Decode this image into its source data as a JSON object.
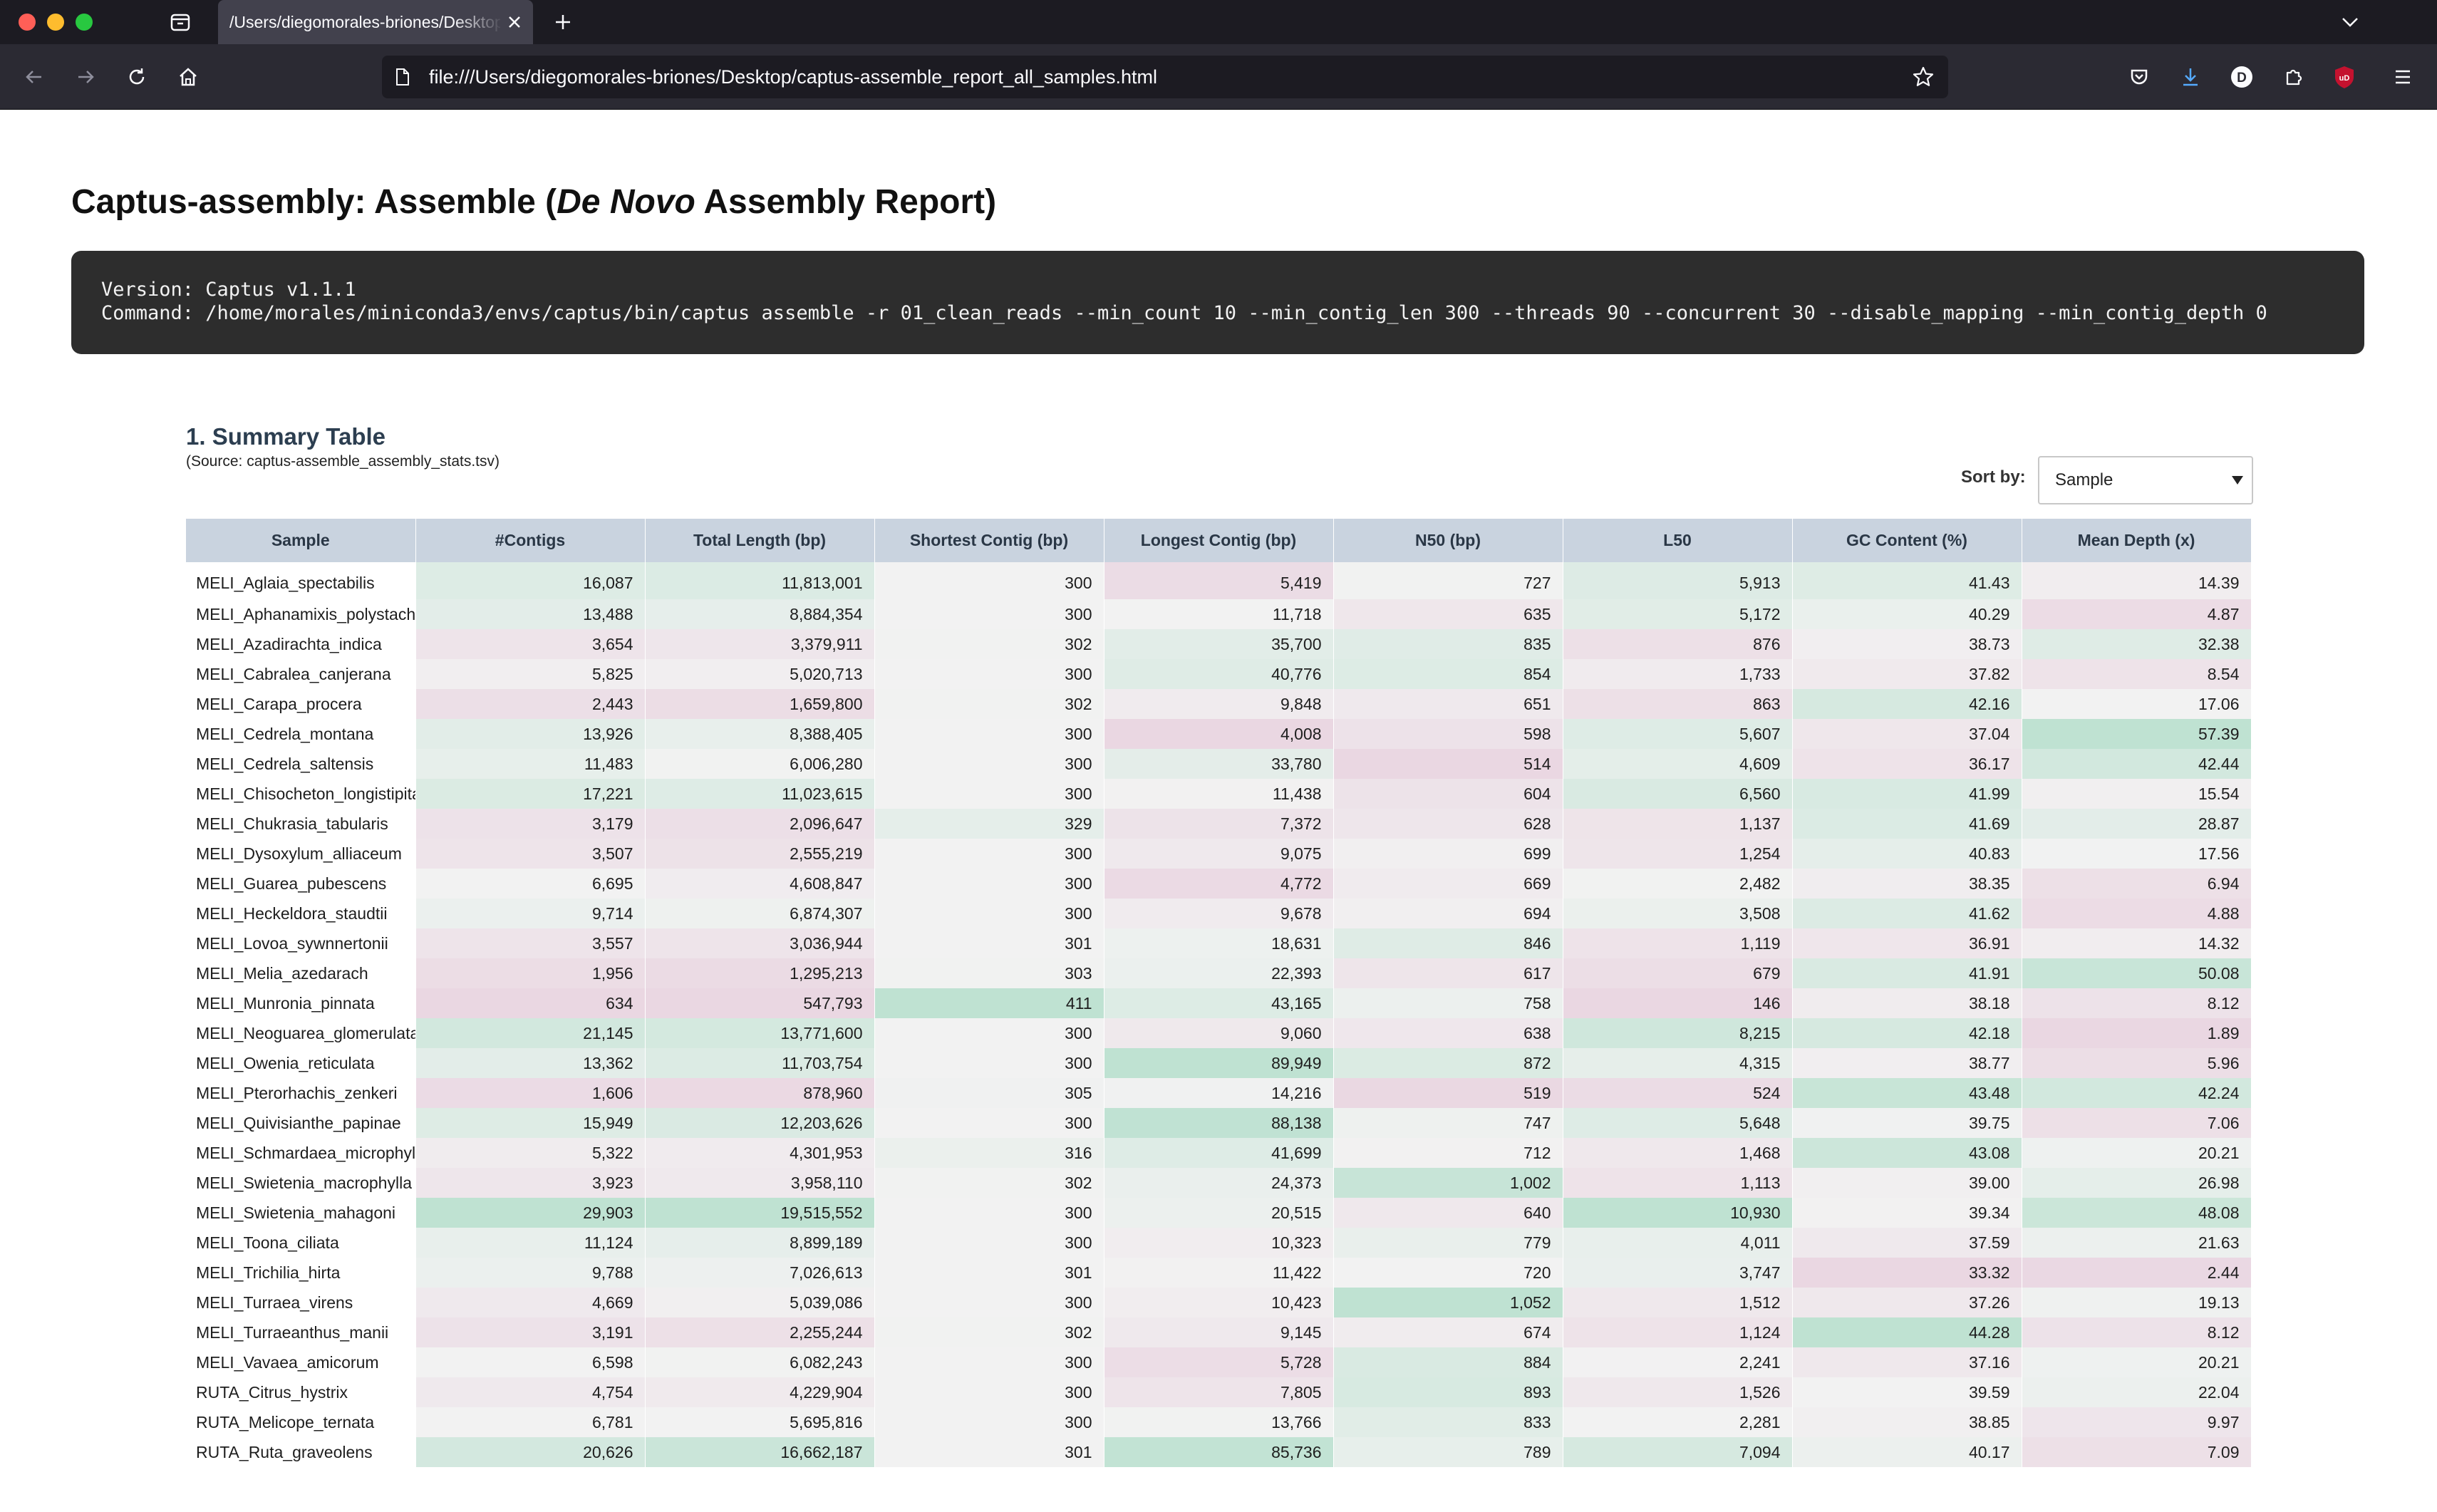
{
  "browser": {
    "tab_title": "/Users/diegomorales-briones/Desktop/captus-assemble_report_all_samples.html",
    "url": "file:///Users/diegomorales-briones/Desktop/captus-assemble_report_all_samples.html",
    "profile_initial": "D",
    "extension_badge": "uD"
  },
  "report": {
    "title_prefix": "Captus-assembly: Assemble (",
    "title_italic": "De Novo",
    "title_suffix": " Assembly Report)",
    "version_line": "Version: Captus v1.1.1",
    "command_line": "Command: /home/morales/miniconda3/envs/captus/bin/captus assemble -r 01_clean_reads --min_count 10 --min_contig_len 300 --threads 90 --concurrent 30 --disable_mapping --min_contig_depth 0"
  },
  "summary": {
    "section_title": "1. Summary Table",
    "source_note": "(Source: captus-assemble_assembly_stats.tsv)",
    "sort_label": "Sort by:",
    "sort_value": "Sample",
    "columns": [
      "Sample",
      "#Contigs",
      "Total Length (bp)",
      "Shortest Contig (bp)",
      "Longest Contig (bp)",
      "N50 (bp)",
      "L50",
      "GC Content (%)",
      "Mean Depth (x)"
    ],
    "rows": [
      [
        "MELI_Aglaia_spectabilis",
        "16,087",
        "11,813,001",
        "300",
        "5,419",
        "727",
        "5,913",
        "41.43",
        "14.39"
      ],
      [
        "MELI_Aphanamixis_polystachya",
        "13,488",
        "8,884,354",
        "300",
        "11,718",
        "635",
        "5,172",
        "40.29",
        "4.87"
      ],
      [
        "MELI_Azadirachta_indica",
        "3,654",
        "3,379,911",
        "302",
        "35,700",
        "835",
        "876",
        "38.73",
        "32.38"
      ],
      [
        "MELI_Cabralea_canjerana",
        "5,825",
        "5,020,713",
        "300",
        "40,776",
        "854",
        "1,733",
        "37.82",
        "8.54"
      ],
      [
        "MELI_Carapa_procera",
        "2,443",
        "1,659,800",
        "302",
        "9,848",
        "651",
        "863",
        "42.16",
        "17.06"
      ],
      [
        "MELI_Cedrela_montana",
        "13,926",
        "8,388,405",
        "300",
        "4,008",
        "598",
        "5,607",
        "37.04",
        "57.39"
      ],
      [
        "MELI_Cedrela_saltensis",
        "11,483",
        "6,006,280",
        "300",
        "33,780",
        "514",
        "4,609",
        "36.17",
        "42.44"
      ],
      [
        "MELI_Chisocheton_longistipitatus",
        "17,221",
        "11,023,615",
        "300",
        "11,438",
        "604",
        "6,560",
        "41.99",
        "15.54"
      ],
      [
        "MELI_Chukrasia_tabularis",
        "3,179",
        "2,096,647",
        "329",
        "7,372",
        "628",
        "1,137",
        "41.69",
        "28.87"
      ],
      [
        "MELI_Dysoxylum_alliaceum",
        "3,507",
        "2,555,219",
        "300",
        "9,075",
        "699",
        "1,254",
        "40.83",
        "17.56"
      ],
      [
        "MELI_Guarea_pubescens",
        "6,695",
        "4,608,847",
        "300",
        "4,772",
        "669",
        "2,482",
        "38.35",
        "6.94"
      ],
      [
        "MELI_Heckeldora_staudtii",
        "9,714",
        "6,874,307",
        "300",
        "9,678",
        "694",
        "3,508",
        "41.62",
        "4.88"
      ],
      [
        "MELI_Lovoa_sywnnertonii",
        "3,557",
        "3,036,944",
        "301",
        "18,631",
        "846",
        "1,119",
        "36.91",
        "14.32"
      ],
      [
        "MELI_Melia_azedarach",
        "1,956",
        "1,295,213",
        "303",
        "22,393",
        "617",
        "679",
        "41.91",
        "50.08"
      ],
      [
        "MELI_Munronia_pinnata",
        "634",
        "547,793",
        "411",
        "43,165",
        "758",
        "146",
        "38.18",
        "8.12"
      ],
      [
        "MELI_Neoguarea_glomerulata",
        "21,145",
        "13,771,600",
        "300",
        "9,060",
        "638",
        "8,215",
        "42.18",
        "1.89"
      ],
      [
        "MELI_Owenia_reticulata",
        "13,362",
        "11,703,754",
        "300",
        "89,949",
        "872",
        "4,315",
        "38.77",
        "5.96"
      ],
      [
        "MELI_Pterorhachis_zenkeri",
        "1,606",
        "878,960",
        "305",
        "14,216",
        "519",
        "524",
        "43.48",
        "42.24"
      ],
      [
        "MELI_Quivisianthe_papinae",
        "15,949",
        "12,203,626",
        "300",
        "88,138",
        "747",
        "5,648",
        "39.75",
        "7.06"
      ],
      [
        "MELI_Schmardaea_microphylla",
        "5,322",
        "4,301,953",
        "316",
        "41,699",
        "712",
        "1,468",
        "43.08",
        "20.21"
      ],
      [
        "MELI_Swietenia_macrophylla",
        "3,923",
        "3,958,110",
        "302",
        "24,373",
        "1,002",
        "1,113",
        "39.00",
        "26.98"
      ],
      [
        "MELI_Swietenia_mahagoni",
        "29,903",
        "19,515,552",
        "300",
        "20,515",
        "640",
        "10,930",
        "39.34",
        "48.08"
      ],
      [
        "MELI_Toona_ciliata",
        "11,124",
        "8,899,189",
        "300",
        "10,323",
        "779",
        "4,011",
        "37.59",
        "21.63"
      ],
      [
        "MELI_Trichilia_hirta",
        "9,788",
        "7,026,613",
        "301",
        "11,422",
        "720",
        "3,747",
        "33.32",
        "2.44"
      ],
      [
        "MELI_Turraea_virens",
        "4,669",
        "5,039,086",
        "300",
        "10,423",
        "1,052",
        "1,512",
        "37.26",
        "19.13"
      ],
      [
        "MELI_Turraeanthus_manii",
        "3,191",
        "2,255,244",
        "302",
        "9,145",
        "674",
        "1,124",
        "44.28",
        "8.12"
      ],
      [
        "MELI_Vavaea_amicorum",
        "6,598",
        "6,082,243",
        "300",
        "5,728",
        "884",
        "2,241",
        "37.16",
        "20.21"
      ],
      [
        "RUTA_Citrus_hystrix",
        "4,754",
        "4,229,904",
        "300",
        "7,805",
        "893",
        "1,526",
        "39.59",
        "22.04"
      ],
      [
        "RUTA_Melicope_ternata",
        "6,781",
        "5,695,816",
        "300",
        "13,766",
        "833",
        "2,281",
        "38.85",
        "9.97"
      ],
      [
        "RUTA_Ruta_graveolens",
        "20,626",
        "16,662,187",
        "301",
        "85,736",
        "789",
        "7,094",
        "40.17",
        "7.09"
      ]
    ]
  },
  "colors": {
    "header_bg": "#c9d3df",
    "scale_low": "#ead7e2",
    "scale_mid": "#f2f2f2",
    "scale_high": "#bfe2d2"
  }
}
